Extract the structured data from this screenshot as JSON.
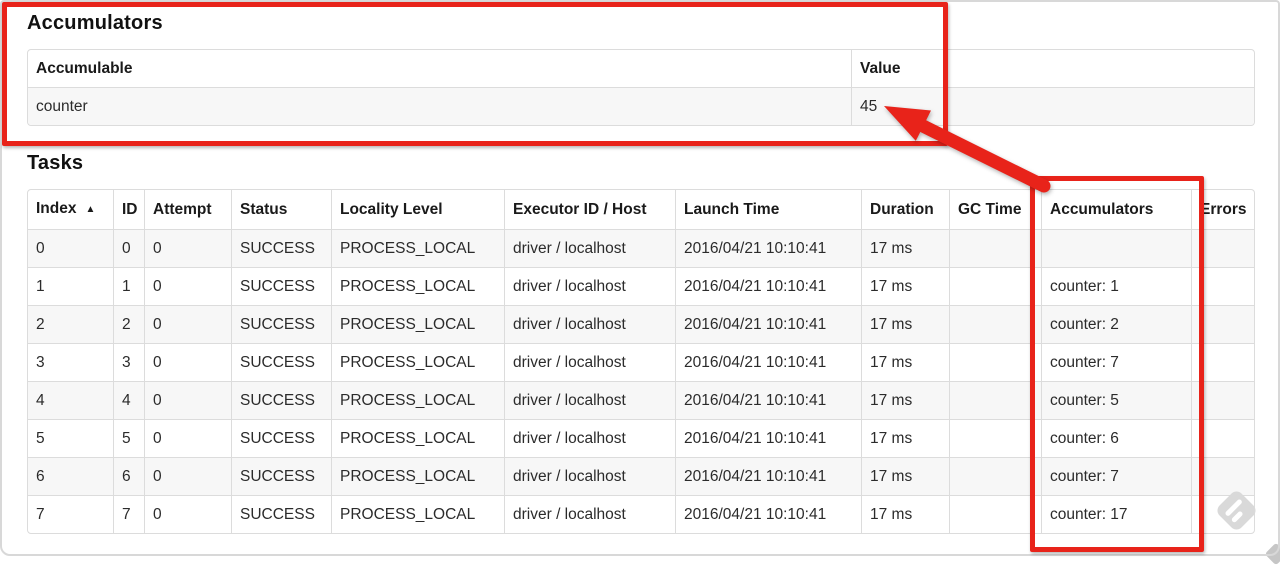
{
  "accumulators": {
    "title": "Accumulators",
    "table": {
      "headers": [
        "Accumulable",
        "Value"
      ],
      "rows": [
        {
          "cells": [
            "counter",
            "45"
          ]
        }
      ]
    }
  },
  "tasks": {
    "title": "Tasks",
    "table": {
      "headers": [
        "Index",
        "ID",
        "Attempt",
        "Status",
        "Locality Level",
        "Executor ID / Host",
        "Launch Time",
        "Duration",
        "GC Time",
        "Accumulators",
        "Errors"
      ],
      "sort": {
        "column": "Index",
        "direction": "ascending",
        "icon": "▲"
      },
      "rows": [
        {
          "cells": [
            "0",
            "0",
            "0",
            "SUCCESS",
            "PROCESS_LOCAL",
            "driver / localhost",
            "2016/04/21 10:10:41",
            "17 ms",
            "",
            "",
            ""
          ]
        },
        {
          "cells": [
            "1",
            "1",
            "0",
            "SUCCESS",
            "PROCESS_LOCAL",
            "driver / localhost",
            "2016/04/21 10:10:41",
            "17 ms",
            "",
            "counter: 1",
            ""
          ]
        },
        {
          "cells": [
            "2",
            "2",
            "0",
            "SUCCESS",
            "PROCESS_LOCAL",
            "driver / localhost",
            "2016/04/21 10:10:41",
            "17 ms",
            "",
            "counter: 2",
            ""
          ]
        },
        {
          "cells": [
            "3",
            "3",
            "0",
            "SUCCESS",
            "PROCESS_LOCAL",
            "driver / localhost",
            "2016/04/21 10:10:41",
            "17 ms",
            "",
            "counter: 7",
            ""
          ]
        },
        {
          "cells": [
            "4",
            "4",
            "0",
            "SUCCESS",
            "PROCESS_LOCAL",
            "driver / localhost",
            "2016/04/21 10:10:41",
            "17 ms",
            "",
            "counter: 5",
            ""
          ]
        },
        {
          "cells": [
            "5",
            "5",
            "0",
            "SUCCESS",
            "PROCESS_LOCAL",
            "driver / localhost",
            "2016/04/21 10:10:41",
            "17 ms",
            "",
            "counter: 6",
            ""
          ]
        },
        {
          "cells": [
            "6",
            "6",
            "0",
            "SUCCESS",
            "PROCESS_LOCAL",
            "driver / localhost",
            "2016/04/21 10:10:41",
            "17 ms",
            "",
            "counter: 7",
            ""
          ]
        },
        {
          "cells": [
            "7",
            "7",
            "0",
            "SUCCESS",
            "PROCESS_LOCAL",
            "driver / localhost",
            "2016/04/21 10:10:41",
            "17 ms",
            "",
            "counter: 17",
            ""
          ]
        }
      ]
    }
  },
  "annotations": {
    "highlight_color": "#e8231a",
    "box1_target": "accumulators-summary-table",
    "box2_target": "accumulators-column",
    "arrow_points_to": "45"
  },
  "icons": {
    "sort_ascending": "▲",
    "watermark": "skitch-diamond-logo"
  }
}
